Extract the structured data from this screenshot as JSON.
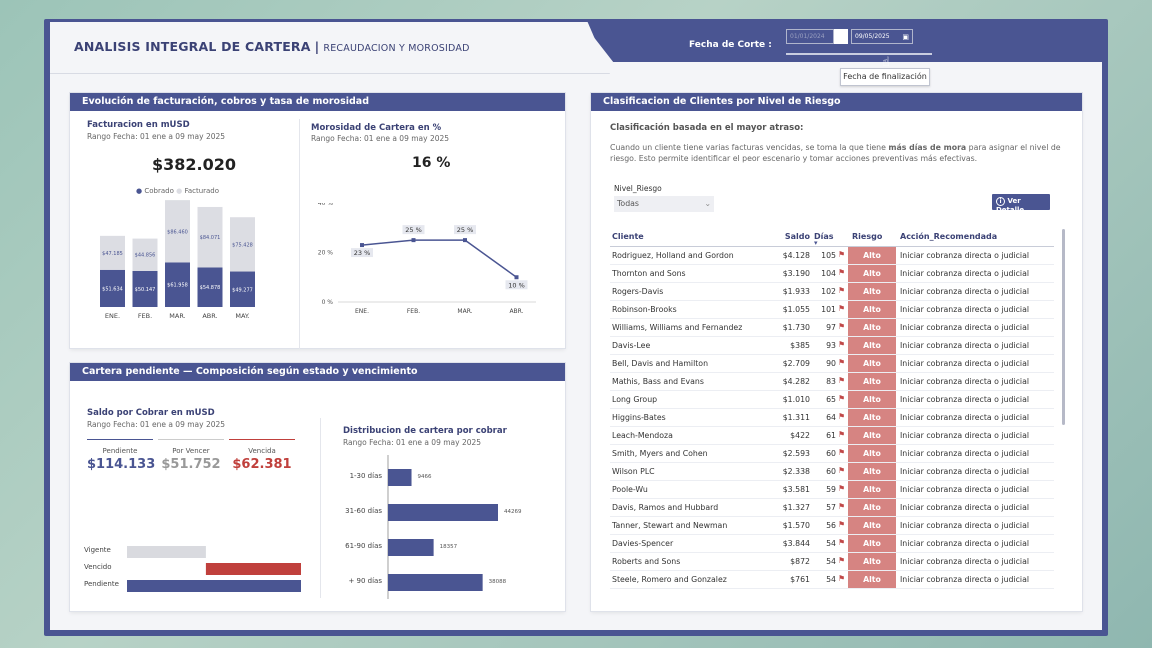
{
  "header": {
    "title": "ANALISIS INTEGRAL DE CARTERA",
    "separator": "|",
    "subtitle": "RECAUDACION Y MOROSIDAD",
    "fecha_label": "Fecha de Corte :",
    "date_start": "01/01/2024",
    "date_end": "09/05/2025",
    "tooltip": "Fecha de finalización"
  },
  "panel1": {
    "title": "Evolución de facturación, cobros y tasa de morosidad",
    "left": {
      "title": "Facturacion en mUSD",
      "range": "Rango Fecha: 01 ene a 09 may 2025",
      "kpi": "$382.020",
      "legend_cobrado": "Cobrado",
      "legend_facturado": "Facturado"
    },
    "right": {
      "title": "Morosidad de Cartera en %",
      "range": "Rango Fecha: 01 ene a 09 may 2025",
      "kpi": "16 %"
    }
  },
  "panel2": {
    "title": "Cartera pendiente — Composición según estado  y vencimiento",
    "left": {
      "title": "Saldo por Cobrar en mUSD",
      "range": "Rango Fecha: 01 ene a 09 may 2025",
      "kpis": [
        {
          "label": "Pendiente",
          "value": "$114.133",
          "color": "#4a5592"
        },
        {
          "label": "Por Vencer",
          "value": "$51.752",
          "color": "#999999"
        },
        {
          "label": "Vencida",
          "value": "$62.381",
          "color": "#c0403c"
        }
      ],
      "bar_labels": [
        "Vigente",
        "Vencido",
        "Pendiente"
      ]
    },
    "right": {
      "title": "Distribucion de cartera por cobrar",
      "range": "Rango Fecha: 01 ene a 09 may 2025"
    }
  },
  "panel3": {
    "title": "Clasificacion de Clientes por Nivel de Riesgo",
    "subtitle": "Clasificación basada en el mayor atraso:",
    "desc_pre": "Cuando un cliente tiene varias facturas vencidas, se toma la que tiene ",
    "desc_bold": "más días de mora",
    "desc_post": " para asignar el nivel de riesgo. Esto permite identificar el peor escenario y tomar acciones preventivas más efectivas.",
    "filter_label": "Nivel_Riesgo",
    "filter_value": "Todas",
    "detail_button": "Ver Detalle",
    "columns": [
      "Cliente",
      "Saldo",
      "Días",
      "Riesgo",
      "Acción_Recomendada"
    ],
    "rows": [
      {
        "cliente": "Rodriguez, Holland and Gordon",
        "saldo": "$4.128",
        "dias": "105",
        "riesgo": "Alto",
        "accion": "Iniciar cobranza directa o judicial"
      },
      {
        "cliente": "Thornton and Sons",
        "saldo": "$3.190",
        "dias": "104",
        "riesgo": "Alto",
        "accion": "Iniciar cobranza directa o judicial"
      },
      {
        "cliente": "Rogers-Davis",
        "saldo": "$1.933",
        "dias": "102",
        "riesgo": "Alto",
        "accion": "Iniciar cobranza directa o judicial"
      },
      {
        "cliente": "Robinson-Brooks",
        "saldo": "$1.055",
        "dias": "101",
        "riesgo": "Alto",
        "accion": "Iniciar cobranza directa o judicial"
      },
      {
        "cliente": "Williams, Williams and Fernandez",
        "saldo": "$1.730",
        "dias": "97",
        "riesgo": "Alto",
        "accion": "Iniciar cobranza directa o judicial"
      },
      {
        "cliente": "Davis-Lee",
        "saldo": "$385",
        "dias": "93",
        "riesgo": "Alto",
        "accion": "Iniciar cobranza directa o judicial"
      },
      {
        "cliente": "Bell, Davis and Hamilton",
        "saldo": "$2.709",
        "dias": "90",
        "riesgo": "Alto",
        "accion": "Iniciar cobranza directa o judicial"
      },
      {
        "cliente": "Mathis, Bass and Evans",
        "saldo": "$4.282",
        "dias": "83",
        "riesgo": "Alto",
        "accion": "Iniciar cobranza directa o judicial"
      },
      {
        "cliente": "Long Group",
        "saldo": "$1.010",
        "dias": "65",
        "riesgo": "Alto",
        "accion": "Iniciar cobranza directa o judicial"
      },
      {
        "cliente": "Higgins-Bates",
        "saldo": "$1.311",
        "dias": "64",
        "riesgo": "Alto",
        "accion": "Iniciar cobranza directa o judicial"
      },
      {
        "cliente": "Leach-Mendoza",
        "saldo": "$422",
        "dias": "61",
        "riesgo": "Alto",
        "accion": "Iniciar cobranza directa o judicial"
      },
      {
        "cliente": "Smith, Myers and Cohen",
        "saldo": "$2.593",
        "dias": "60",
        "riesgo": "Alto",
        "accion": "Iniciar cobranza directa o judicial"
      },
      {
        "cliente": "Wilson PLC",
        "saldo": "$2.338",
        "dias": "60",
        "riesgo": "Alto",
        "accion": "Iniciar cobranza directa o judicial"
      },
      {
        "cliente": "Poole-Wu",
        "saldo": "$3.581",
        "dias": "59",
        "riesgo": "Alto",
        "accion": "Iniciar cobranza directa o judicial"
      },
      {
        "cliente": "Davis, Ramos and Hubbard",
        "saldo": "$1.327",
        "dias": "57",
        "riesgo": "Alto",
        "accion": "Iniciar cobranza directa o judicial"
      },
      {
        "cliente": "Tanner, Stewart and Newman",
        "saldo": "$1.570",
        "dias": "56",
        "riesgo": "Alto",
        "accion": "Iniciar cobranza directa o judicial"
      },
      {
        "cliente": "Davies-Spencer",
        "saldo": "$3.844",
        "dias": "54",
        "riesgo": "Alto",
        "accion": "Iniciar cobranza directa o judicial"
      },
      {
        "cliente": "Roberts and Sons",
        "saldo": "$872",
        "dias": "54",
        "riesgo": "Alto",
        "accion": "Iniciar cobranza directa o judicial"
      },
      {
        "cliente": "Steele, Romero and Gonzalez",
        "saldo": "$761",
        "dias": "54",
        "riesgo": "Alto",
        "accion": "Iniciar cobranza directa o judicial"
      }
    ]
  },
  "colors": {
    "primary": "#4a5592",
    "light_bar": "#dcdde3",
    "alert": "#c0403c",
    "risk": "#d68482"
  },
  "chart_data": [
    {
      "type": "bar",
      "stacked": true,
      "categories": [
        "ENE.",
        "FEB.",
        "MAR.",
        "ABR.",
        "MAY."
      ],
      "series": [
        {
          "name": "Cobrado",
          "values": [
            51.634,
            50.147,
            61.958,
            54.878,
            49.277
          ],
          "labels": [
            "$51.634",
            "$50.147",
            "$61.958",
            "$54.878",
            "$49.277"
          ]
        },
        {
          "name": "Facturado",
          "values": [
            47.185,
            44.856,
            86.46,
            84.071,
            75.428
          ],
          "labels": [
            "$47.185",
            "$44.856",
            "$86.460",
            "$84.071",
            "$75.428"
          ]
        }
      ]
    },
    {
      "type": "line",
      "categories": [
        "ENE.",
        "FEB.",
        "MAR.",
        "ABR."
      ],
      "values": [
        23,
        25,
        25,
        10
      ],
      "labels": [
        "23 %",
        "25 %",
        "25 %",
        "10 %"
      ],
      "ytick_labels": [
        "0 %",
        "20 %",
        "40 %"
      ],
      "ylim": [
        0,
        40
      ]
    },
    {
      "type": "bar",
      "orientation": "horizontal",
      "categories": [
        "1-30 días",
        "31-60 días",
        "61-90 días",
        "+ 90 días"
      ],
      "values": [
        9466,
        44269,
        18357,
        38088
      ]
    },
    {
      "type": "bar",
      "orientation": "horizontal",
      "categories": [
        "Vigente",
        "Vencido",
        "Pendiente"
      ],
      "values": [
        51.752,
        62.381,
        114.133
      ]
    }
  ]
}
